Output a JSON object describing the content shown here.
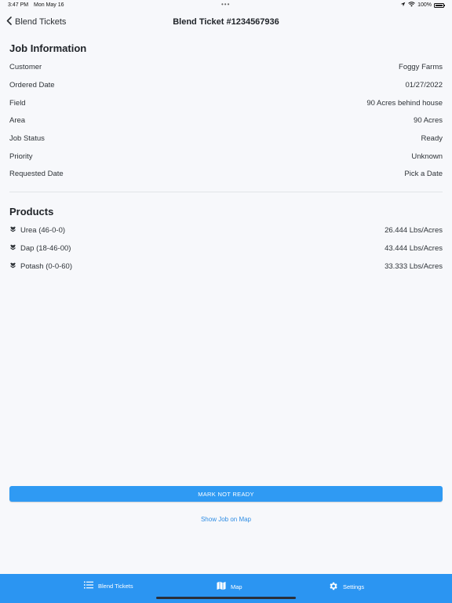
{
  "status": {
    "time": "3:47 PM",
    "date": "Mon May 16",
    "battery": "100%"
  },
  "nav": {
    "back_label": "Blend Tickets",
    "title": "Blend Ticket #1234567936"
  },
  "job": {
    "section_title": "Job Information",
    "rows": [
      {
        "label": "Customer",
        "value": "Foggy Farms"
      },
      {
        "label": "Ordered Date",
        "value": "01/27/2022"
      },
      {
        "label": "Field",
        "value": "90 Acres behind house"
      },
      {
        "label": "Area",
        "value": "90 Acres"
      },
      {
        "label": "Job Status",
        "value": "Ready"
      },
      {
        "label": "Priority",
        "value": "Unknown"
      },
      {
        "label": "Requested Date",
        "value": "Pick a Date"
      }
    ]
  },
  "products": {
    "section_title": "Products",
    "items": [
      {
        "icon": "product-bag-icon",
        "name": "Urea (46-0-0)",
        "rate": "26.444 Lbs/Acres"
      },
      {
        "icon": "product-bag-icon",
        "name": "Dap (18-46-00)",
        "rate": "43.444 Lbs/Acres"
      },
      {
        "icon": "product-bag-icon",
        "name": "Potash (0-0-60)",
        "rate": "33.333 Lbs/Acres"
      }
    ]
  },
  "actions": {
    "primary_label": "MARK NOT READY",
    "link_label": "Show Job on Map"
  },
  "tabs": [
    {
      "icon": "list-icon",
      "label": "Blend Tickets"
    },
    {
      "icon": "map-icon",
      "label": "Map"
    },
    {
      "icon": "gear-icon",
      "label": "Settings"
    }
  ],
  "colors": {
    "accent": "#2f9af3",
    "tab_bar": "#2b95f2",
    "link": "#2f8de4",
    "background": "#f7f8fb"
  }
}
